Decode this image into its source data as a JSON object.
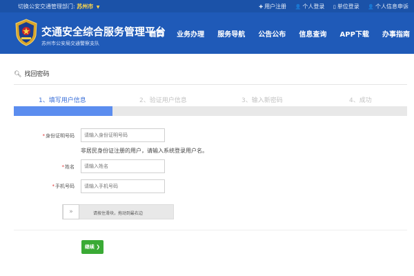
{
  "topbar": {
    "switch_label": "切换公安交通管理部门:",
    "city": "苏州市",
    "links": [
      {
        "icon": "plus-icon",
        "glyph": "✚",
        "label": "用户注册"
      },
      {
        "icon": "user-icon",
        "glyph": "👤",
        "label": "个人登录"
      },
      {
        "icon": "building-icon",
        "glyph": "▯",
        "label": "单位登录"
      },
      {
        "icon": "user-apply-icon",
        "glyph": "👤",
        "label": "个人信息申诉"
      }
    ]
  },
  "header": {
    "title": "交通安全综合服务管理平台",
    "subtitle": "苏州市公安局交通警察支队",
    "nav": [
      "首页",
      "业务办理",
      "服务导航",
      "公告公布",
      "信息查询",
      "APP下载",
      "办事指南"
    ]
  },
  "page": {
    "title": "找回密码"
  },
  "steps": {
    "items": [
      "1、填写用户信息",
      "2、验证用户信息",
      "3、输入新密码",
      "4、成功"
    ],
    "active_index": 0,
    "progress": 0.25
  },
  "form": {
    "id_label": "身份证明号码",
    "id_placeholder": "请输入身份证明号码",
    "id_hint": "非居民身份证注册的用户，请输入系统登录用户名。",
    "name_label": "姓名",
    "name_placeholder": "请输入姓名",
    "phone_label": "手机号码",
    "phone_placeholder": "请输入手机号码",
    "required_mark": "*"
  },
  "slider": {
    "handle": "»",
    "text": "请按住滑块，拖动到最右边"
  },
  "submit": {
    "label": "继续 ❯"
  },
  "colors": {
    "topbar": "#1b52a8",
    "header": "#1f5ab8",
    "active_step": "#3a6fd8",
    "progress_fill": "#5b8def",
    "button": "#3aaa35"
  }
}
